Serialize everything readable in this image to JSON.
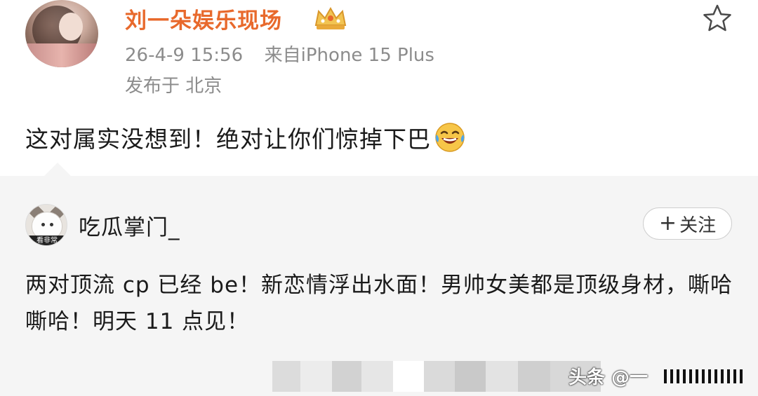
{
  "post": {
    "author": "刘一朵娱乐现场",
    "timestamp": "26-4-9 15:56",
    "source": "来自iPhone 15 Plus",
    "location": "发布于 北京",
    "text": "这对属实没想到！绝对让你们惊掉下巴",
    "emoji": "laughing-tears",
    "author_color": "#e8692c"
  },
  "repost": {
    "author": "吃瓜掌门_",
    "avatar_caption": "看非常",
    "follow_label": "关注",
    "follow_plus": "+",
    "text": "两对顶流 cp 已经 be！新恋情浮出水面！男帅女美都是顶级身材，嘶哈嘶哈！明天 11 点见！"
  },
  "watermark": {
    "text": "头条 @一"
  },
  "icons": {
    "favorite": "star-icon",
    "badge": "crown-icon"
  }
}
